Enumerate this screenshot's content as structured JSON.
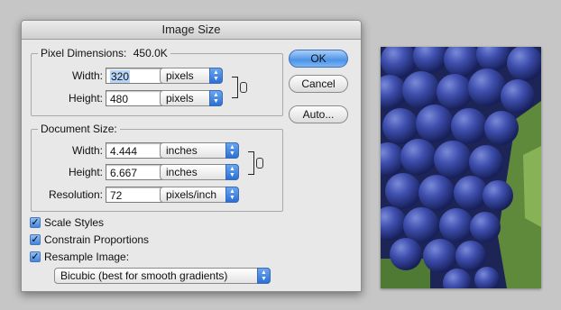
{
  "window": {
    "title": "Image Size"
  },
  "pixel_dimensions": {
    "legend": "Pixel Dimensions:",
    "size": "450.0K",
    "width_label": "Width:",
    "width_value": "320",
    "width_unit": "pixels",
    "height_label": "Height:",
    "height_value": "480",
    "height_unit": "pixels"
  },
  "document_size": {
    "legend": "Document Size:",
    "width_label": "Width:",
    "width_value": "4.444",
    "width_unit": "inches",
    "height_label": "Height:",
    "height_value": "6.667",
    "height_unit": "inches",
    "resolution_label": "Resolution:",
    "resolution_value": "72",
    "resolution_unit": "pixels/inch"
  },
  "buttons": {
    "ok": "OK",
    "cancel": "Cancel",
    "auto": "Auto..."
  },
  "options": {
    "scale_styles": {
      "label": "Scale Styles",
      "checked": true
    },
    "constrain_proportions": {
      "label": "Constrain Proportions",
      "checked": true
    },
    "resample_image": {
      "label": "Resample Image:",
      "checked": true
    },
    "resample_method": "Bicubic (best for smooth gradients)"
  },
  "icons": {
    "link": "chain-link-icon",
    "popup": "up-down-arrows-icon",
    "check": "checkmark-icon"
  },
  "colors": {
    "accent": "#4c93e8",
    "grape": "#3a4aa6",
    "leaf": "#5f8a3c"
  }
}
